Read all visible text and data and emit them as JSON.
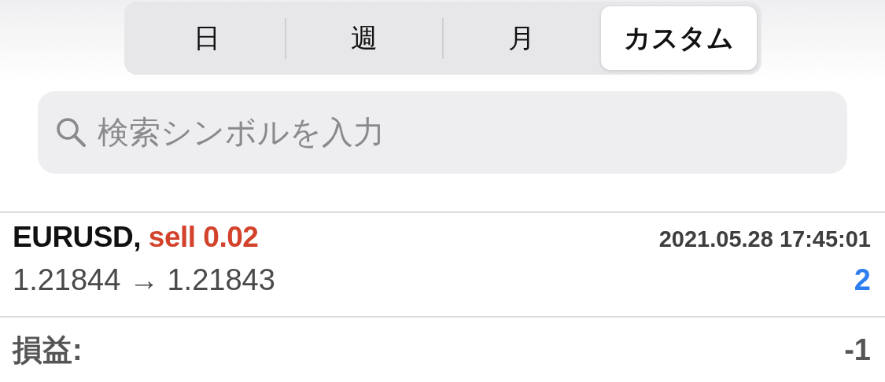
{
  "periods": [
    {
      "label": "日",
      "selected": false
    },
    {
      "label": "週",
      "selected": false
    },
    {
      "label": "月",
      "selected": false
    },
    {
      "label": "カスタム",
      "selected": true
    }
  ],
  "search": {
    "placeholder": "検索シンボルを入力"
  },
  "deals": [
    {
      "symbol": "EURUSD,",
      "side": "sell 0.02",
      "kind": "sell",
      "time": "2021.05.28 17:45:01",
      "prices": "1.21844 → 1.21843",
      "count": "2"
    }
  ],
  "summary": {
    "label": "損益:",
    "value": "-1"
  }
}
